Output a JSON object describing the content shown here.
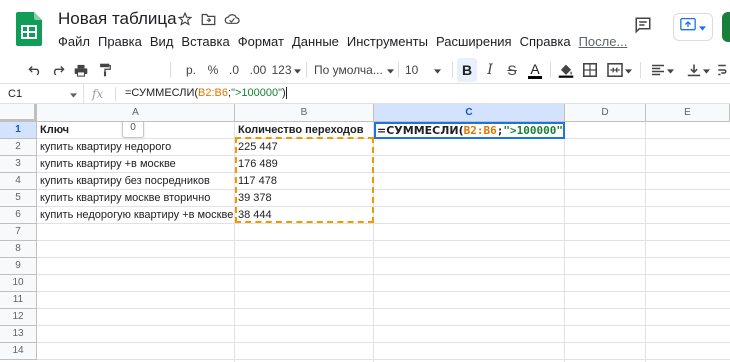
{
  "app": {
    "title": "Новая таблица",
    "brand_color": "#0f9d58",
    "accent_color": "#1a73e8",
    "range_color": "#f29900"
  },
  "menu": [
    "Файл",
    "Правка",
    "Вид",
    "Вставка",
    "Формат",
    "Данные",
    "Инструменты",
    "Расширения",
    "Справка"
  ],
  "last_edit": "После...",
  "toolbar": {
    "zoom": "0",
    "percent": "%",
    "currency": "р.",
    "decimal_decrease": ".0",
    "decimal_increase": ".00",
    "more_formats": "123",
    "font": "По умолча...",
    "font_size": "10",
    "bold": "B",
    "strikethrough": "S",
    "text_color": "A"
  },
  "formula_bar": {
    "name_box": "C1",
    "fx": "fx",
    "formula_prefix": "=СУММЕСЛИ(",
    "formula_range": "B2:B6",
    "formula_sep": ";",
    "formula_string": "\">100000\"",
    "formula_suffix": ")"
  },
  "grid": {
    "columns": [
      "A",
      "B",
      "C",
      "D",
      "E"
    ],
    "rows": [
      "1",
      "2",
      "3",
      "4",
      "5",
      "6",
      "7",
      "8",
      "9",
      "10",
      "11",
      "12",
      "13",
      "14"
    ],
    "headers": {
      "A1": "Ключ",
      "B1": "Количество переходов"
    },
    "keys": [
      "купить квартиру недорого",
      "купить квартиру +в москве",
      "купить квартиру без посредников",
      "купить квартиру москве вторично",
      "купить недорогую квартиру +в москве"
    ],
    "counts": [
      "225 447",
      "176 489",
      "117 478",
      "39 378",
      "38 444"
    ],
    "active_cell": {
      "prefix": "=СУММЕСЛИ(",
      "range": "B2:B6",
      "sep": ";",
      "string": "\">100000\"",
      "suffix": ")"
    }
  }
}
